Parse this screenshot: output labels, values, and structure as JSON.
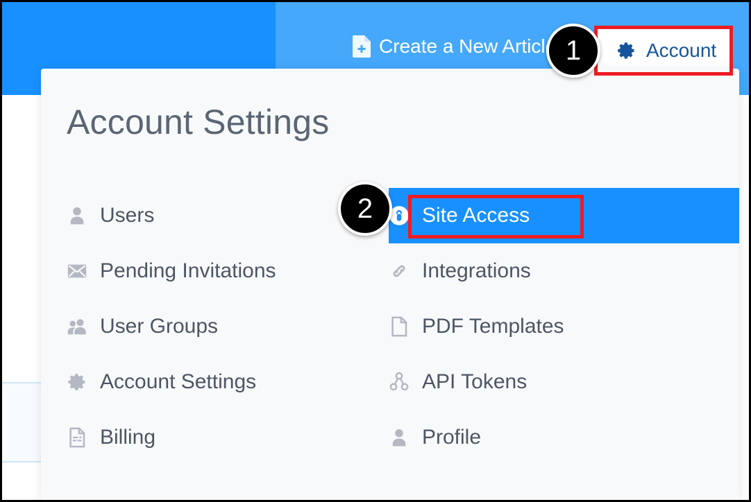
{
  "colors": {
    "topbar_primary": "#1890ff",
    "topbar_secondary": "#45a8fa",
    "panel_bg": "#f8f9fb",
    "highlight_blue": "#1890ff",
    "annotation_red": "#ed1c24",
    "badge_black": "#000000",
    "heading_gray": "#5b6673",
    "menu_text": "#4c5663",
    "icon_gray": "#b4b8c2",
    "account_text": "#16559c"
  },
  "topbar": {
    "create_article": {
      "label": "Create a New Article",
      "icon": "new-document-icon"
    },
    "account_button": {
      "label": "Account",
      "icon": "gear-icon"
    }
  },
  "dropdown": {
    "title": "Account Settings",
    "left_column": [
      {
        "label": "Users",
        "icon": "user-icon"
      },
      {
        "label": "Pending Invitations",
        "icon": "envelope-icon"
      },
      {
        "label": "User Groups",
        "icon": "users-group-icon"
      },
      {
        "label": "Account Settings",
        "icon": "gear-icon"
      },
      {
        "label": "Billing",
        "icon": "invoice-icon"
      }
    ],
    "right_column": [
      {
        "label": "Site Access",
        "icon": "lock-circle-icon",
        "selected": true
      },
      {
        "label": "Integrations",
        "icon": "link-icon",
        "selected": false
      },
      {
        "label": "PDF Templates",
        "icon": "page-icon",
        "selected": false
      },
      {
        "label": "API Tokens",
        "icon": "nodes-icon",
        "selected": false
      },
      {
        "label": "Profile",
        "icon": "user-icon",
        "selected": false
      }
    ]
  },
  "annotations": {
    "badges": [
      {
        "number": "1"
      },
      {
        "number": "2"
      }
    ]
  }
}
